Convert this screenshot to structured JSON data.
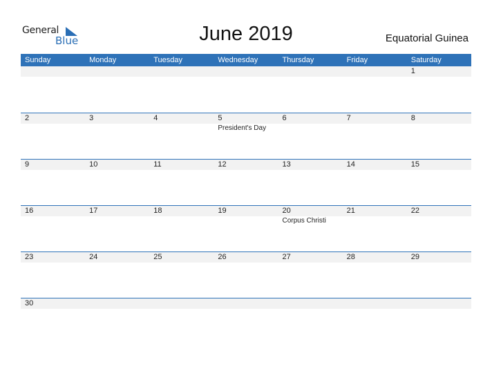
{
  "logo": {
    "line1": "General",
    "line2": "Blue",
    "icon": "triangle-flag-icon"
  },
  "title": "June 2019",
  "country": "Equatorial Guinea",
  "colors": {
    "accent": "#2e72b8",
    "row_bg": "#f2f2f2"
  },
  "weekdays": [
    "Sunday",
    "Monday",
    "Tuesday",
    "Wednesday",
    "Thursday",
    "Friday",
    "Saturday"
  ],
  "weeks": [
    {
      "days": [
        "",
        "",
        "",
        "",
        "",
        "",
        "1"
      ],
      "events": [
        "",
        "",
        "",
        "",
        "",
        "",
        ""
      ]
    },
    {
      "days": [
        "2",
        "3",
        "4",
        "5",
        "6",
        "7",
        "8"
      ],
      "events": [
        "",
        "",
        "",
        "President's Day",
        "",
        "",
        ""
      ]
    },
    {
      "days": [
        "9",
        "10",
        "11",
        "12",
        "13",
        "14",
        "15"
      ],
      "events": [
        "",
        "",
        "",
        "",
        "",
        "",
        ""
      ]
    },
    {
      "days": [
        "16",
        "17",
        "18",
        "19",
        "20",
        "21",
        "22"
      ],
      "events": [
        "",
        "",
        "",
        "",
        "Corpus Christi",
        "",
        ""
      ]
    },
    {
      "days": [
        "23",
        "24",
        "25",
        "26",
        "27",
        "28",
        "29"
      ],
      "events": [
        "",
        "",
        "",
        "",
        "",
        "",
        ""
      ]
    },
    {
      "days": [
        "30",
        "",
        "",
        "",
        "",
        "",
        ""
      ],
      "events": [
        "",
        "",
        "",
        "",
        "",
        "",
        ""
      ]
    }
  ]
}
